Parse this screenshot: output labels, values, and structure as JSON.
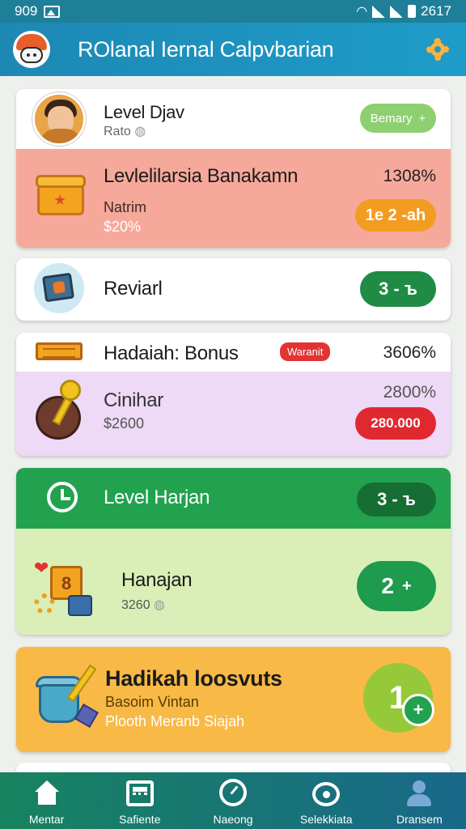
{
  "status_bar": {
    "time": "909",
    "clock": "2617"
  },
  "app_bar": {
    "title": "ROlanal Iernal Calpvbarian"
  },
  "cards": [
    {
      "header": {
        "title": "Level Djav",
        "subtitle": "Rato"
      },
      "header_button": "Bemary",
      "body": {
        "title": "Levlelilarsia Banakamn",
        "label": "Natrim",
        "amount": "$20%",
        "value": "1308%",
        "button": "1e 2 -ah"
      },
      "colors": {
        "header": "#ffffff",
        "body": "#f6a89a",
        "button": "#f39c22",
        "header_button": "#8ed06f"
      }
    },
    {
      "title": "Reviarl",
      "button": "3 - ъ",
      "colors": {
        "button": "#1f8b44"
      }
    },
    {
      "header": {
        "title": "Hadaiah: Bonus",
        "badge": "Waranit",
        "value": "3606%"
      },
      "body": {
        "title": "Cinihar",
        "amount": "$2600",
        "value": "2800%",
        "button": "280.000"
      },
      "colors": {
        "body": "#eed9f7",
        "button": "#e0282f"
      }
    },
    {
      "header": {
        "title": "Level Harjan",
        "button": "3 - ъ"
      },
      "body": {
        "title": "Hanajan",
        "subtitle": "3260",
        "button": "2"
      },
      "colors": {
        "header": "#22a24f",
        "body": "#d9efb7",
        "header_button": "#166e35",
        "button": "#1e9b4d"
      }
    },
    {
      "title": "Hadikah loosvuts",
      "line1": "Basoim Vintan",
      "line2": "Plooth Meranb Siajah",
      "button": "1",
      "colors": {
        "background": "#f8b946",
        "button": "#96c93a"
      }
    }
  ],
  "bottom_nav": [
    {
      "label": "Mentar",
      "icon": "home-icon"
    },
    {
      "label": "Safiente",
      "icon": "calculator-icon"
    },
    {
      "label": "Naeong",
      "icon": "gauge-icon"
    },
    {
      "label": "Selekkiata",
      "icon": "chat-icon"
    },
    {
      "label": "Dransem",
      "icon": "person-icon"
    }
  ]
}
